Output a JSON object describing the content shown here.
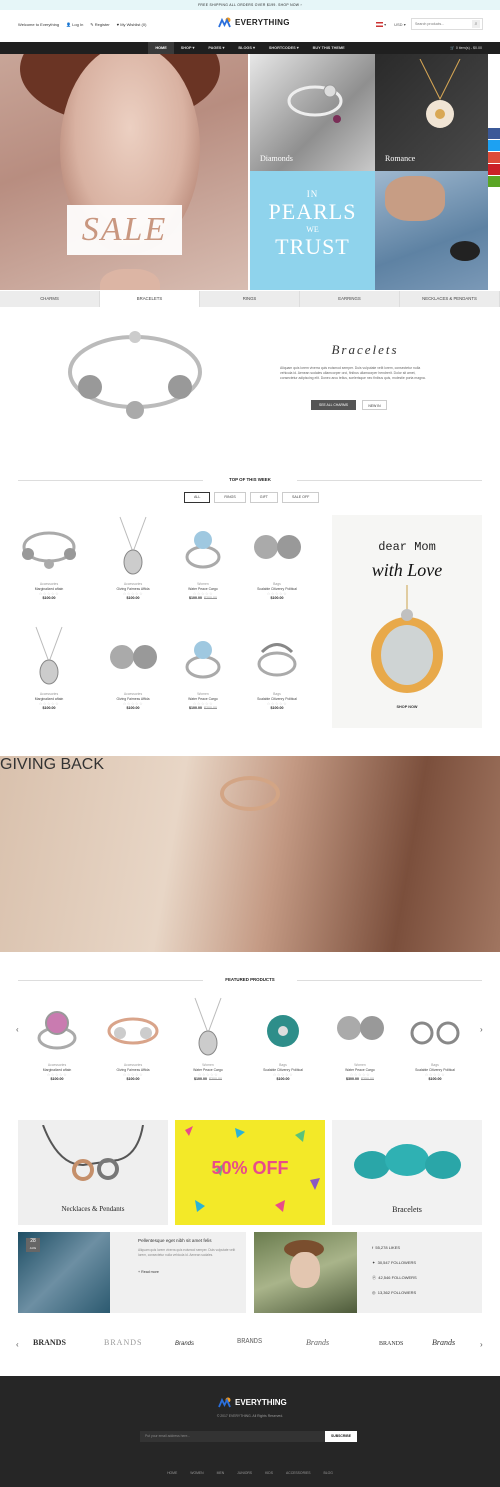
{
  "topbar": {
    "text": "FREE SHIPPING ALL ORDERS OVER $199. SHOP NOW ›"
  },
  "header": {
    "welcome": "Welcome to Everything",
    "login": "Log In",
    "register": "Register",
    "wishlist": "My Wishlist (0)",
    "logo": "EVERYTHING",
    "currency": "USD",
    "search_placeholder": "Search products..."
  },
  "nav": {
    "items": [
      "HOME",
      "SHOP ▾",
      "PAGES ▾",
      "BLOGS ▾",
      "SHORTCODES ▾",
      "BUY THIS THEME"
    ],
    "cart": "0 item(s) - $0.00"
  },
  "hero": {
    "sale": "SALE",
    "diamonds": "Diamonds",
    "romance": "Romance",
    "pearls_in": "IN",
    "pearls_main": "PEARLS",
    "pearls_we": "WE",
    "pearls_trust": "TRUST"
  },
  "tabs": [
    "CHARMS",
    "BRACELETS",
    "RINGS",
    "EARRINGS",
    "NECKLACES & PENDANTS"
  ],
  "bracelets": {
    "title": "Bracelets",
    "desc": "Aliquam quis lorem viverra quis euismod semper. Duis vulputate velit lorem, consectetur nulla vehicula id. Aenean sodales ullamcorper orci, finibus ullamcorper hendrerit. Dolor sit amet, consectetur adipiscing elit. Donec arcu tellus, scelerisque nec finibus quis, molestie porta magna.",
    "btn_all": "SEE ALL CHARMS",
    "btn_new": "NEW IN"
  },
  "top_week": {
    "title": "TOP OF THIS WEEK",
    "filters": [
      "ALL",
      "RINGS",
      "GIFT",
      "SALE OFF"
    ],
    "products": [
      {
        "cat": "Accessories",
        "name": "Marginalized aftain",
        "price": "$100.00",
        "old": ""
      },
      {
        "cat": "Accessories",
        "name": "Giving Fairness Affida",
        "price": "$100.00",
        "old": ""
      },
      {
        "cat": "Women",
        "name": "Water Peace Cargo",
        "price": "$100.00",
        "old": "$300.00"
      },
      {
        "cat": "Bags",
        "name": "Scalable Citizenry Political",
        "price": "$100.00",
        "old": ""
      },
      {
        "cat": "Accessories",
        "name": "Marginalized aftain",
        "price": "$100.00",
        "old": ""
      },
      {
        "cat": "Accessories",
        "name": "Giving Fairness Affida",
        "price": "$100.00",
        "old": ""
      },
      {
        "cat": "Women",
        "name": "Water Peace Cargo",
        "price": "$100.00",
        "old": "$300.00"
      },
      {
        "cat": "Bags",
        "name": "Scalable Citizenry Political",
        "price": "$100.00",
        "old": ""
      }
    ],
    "stars": "☆☆☆☆☆",
    "mom_line1": "dear Mom",
    "mom_line2": "with Love",
    "mom_btn": "SHOP NOW"
  },
  "giving": {
    "title": "GIVING BACK"
  },
  "featured": {
    "title": "FEATURED PRODUCTS",
    "products": [
      {
        "cat": "Accessories",
        "name": "Marginalized aftain",
        "price": "$100.00",
        "old": ""
      },
      {
        "cat": "Accessories",
        "name": "Giving Fairness Affida",
        "price": "$100.00",
        "old": ""
      },
      {
        "cat": "Women",
        "name": "Water Peace Cargo",
        "price": "$100.00",
        "old": "$300.00"
      },
      {
        "cat": "Bags",
        "name": "Scalable Citizenry Political",
        "price": "$100.00",
        "old": ""
      },
      {
        "cat": "Women",
        "name": "Water Peace Cargo",
        "price": "$300.00",
        "old": "$350.00"
      },
      {
        "cat": "Bags",
        "name": "Scalable Citizenry Political",
        "price": "$100.00",
        "old": ""
      }
    ]
  },
  "promos": {
    "necklaces": "Necklaces & Pendants",
    "sale": "50% OFF",
    "bracelets": "Bracelets"
  },
  "blog": {
    "day": "28",
    "month": "AUG",
    "title": "Pellentesque eget nibh sit amet felis",
    "text": "Aliquam quis lorem viverra quis euismod semper. Duis vulputate velit lorem, consectetur nulla vehicula id. Aenean sodales.",
    "more": "+ Read more"
  },
  "social": {
    "facebook": "55,278 LIKES",
    "twitter": "30,547 FOLLOWERS",
    "pinterest": "42,546 FOLLOWERS",
    "instagram": "13,362 FOLLOWERS"
  },
  "brands": [
    "BRANDS",
    "BRANDS",
    "Brands",
    "BRANDS",
    "Brands",
    "BRANDS",
    "Brands"
  ],
  "footer": {
    "logo": "EVERYTHING",
    "copy": "© 2017 EVERYTHING. All Rights Reserved.",
    "email_placeholder": "Put your email address here...",
    "subscribe": "SUBSCRIBE",
    "links": [
      "HOME",
      "WOMEN",
      "MEN",
      "JUNIORS",
      "KIDS",
      "ACCESSORIES",
      "BLOG"
    ]
  }
}
